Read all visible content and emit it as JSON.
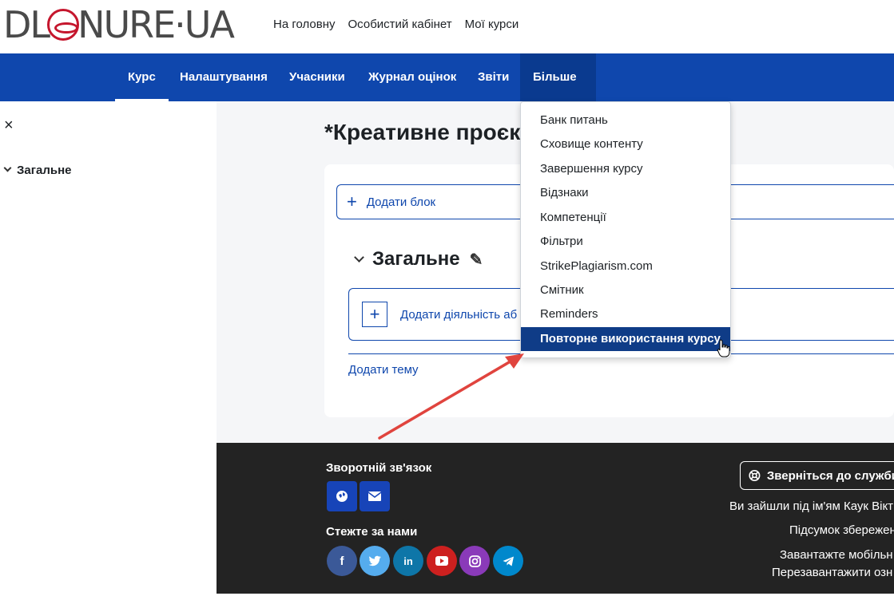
{
  "logo": {
    "text_left": "DL",
    "text_right": "NURE·UA"
  },
  "topnav": [
    "На головну",
    "Особистий кабінет",
    "Мої курси"
  ],
  "secnav": {
    "items": [
      "Курс",
      "Налаштування",
      "Учасники",
      "Журнал оцінок",
      "Звіти"
    ],
    "more": "Більше"
  },
  "drawer": {
    "close": "×",
    "section": "Загальне"
  },
  "course": {
    "title": "*Креативне проєк",
    "add_block": "Додати блок",
    "section_name": "Загальне",
    "add_activity": "Додати діяльність аб",
    "add_topic": "Додати тему"
  },
  "dropdown": {
    "items": [
      "Банк питань",
      "Сховище контенту",
      "Завершення курсу",
      "Відзнаки",
      "Компетенції",
      "Фільтри",
      "StrikePlagiarism.com",
      "Смітник",
      "Reminders",
      "Повторне використання курсу"
    ],
    "highlighted": "Повторне використання курсу"
  },
  "footer": {
    "feedback_title": "Зворотній зв'язок",
    "follow_title": "Стежте за нами",
    "support_button": "Зверніться до служби",
    "logged_in": "Ви зайшли під ім'ям Каук Вікт",
    "data_retention": "Підсумок збережен",
    "mobile_app": "Завантажте мобільн",
    "reset_tour": "Перезавантажити озн"
  },
  "colors": {
    "primary": "#0f47ad",
    "highlight": "#0f3c87",
    "footer_bg": "#232323",
    "annotation_arrow": "#e0443e"
  }
}
